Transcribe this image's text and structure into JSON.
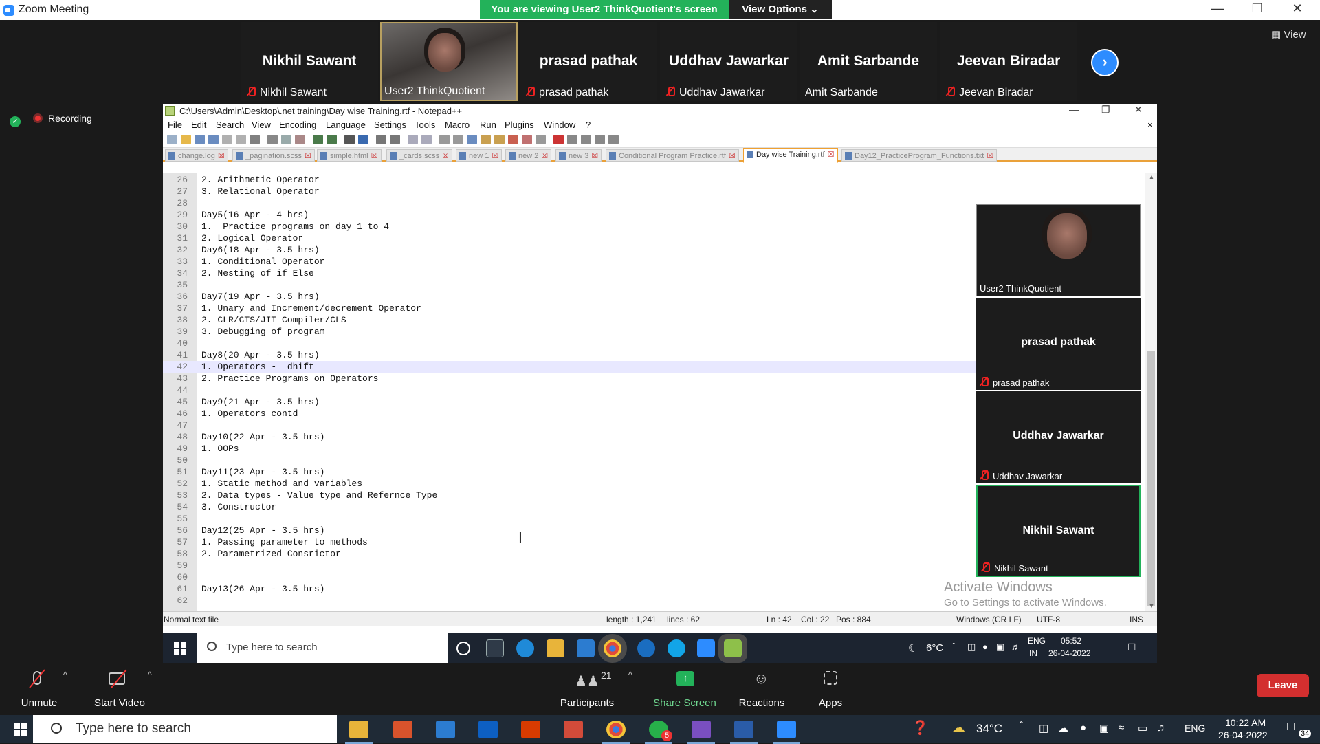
{
  "zoom": {
    "window_title": "Zoom Meeting",
    "viewing_banner": "You are viewing User2 ThinkQuotient's screen",
    "view_options": "View Options ⌄",
    "view_button": "View",
    "recording": "Recording",
    "gallery": [
      {
        "big": "Nikhil Sawant",
        "small": "Nikhil Sawant",
        "muted": true,
        "video": false
      },
      {
        "big": "",
        "small": "User2 ThinkQuotient",
        "muted": false,
        "video": true
      },
      {
        "big": "prasad pathak",
        "small": "prasad pathak",
        "muted": true,
        "video": false
      },
      {
        "big": "Uddhav Jawarkar",
        "small": "Uddhav Jawarkar",
        "muted": true,
        "video": false
      },
      {
        "big": "Amit Sarbande",
        "small": "Amit Sarbande",
        "muted": false,
        "video": false
      },
      {
        "big": "Jeevan Biradar",
        "small": "Jeevan Biradar",
        "muted": true,
        "video": false
      }
    ],
    "toolbar": {
      "unmute": "Unmute",
      "start_video": "Start Video",
      "participants": "Participants",
      "participants_count": "21",
      "share_screen": "Share Screen",
      "reactions": "Reactions",
      "apps": "Apps",
      "leave": "Leave"
    }
  },
  "npp": {
    "title": "C:\\Users\\Admin\\Desktop\\.net training\\Day wise Training.rtf - Notepad++",
    "menu": [
      "File",
      "Edit",
      "Search",
      "View",
      "Encoding",
      "Language",
      "Settings",
      "Tools",
      "Macro",
      "Run",
      "Plugins",
      "Window",
      "?"
    ],
    "tabs": [
      "change.log",
      "_pagination.scss",
      "simple.html",
      "_cards.scss",
      "new 1",
      "new 2",
      "new 3",
      "Conditional Program Practice.rtf",
      "Day wise Training.rtf",
      "Day12_PracticeProgram_Functions.txt"
    ],
    "active_tab": "Day wise Training.rtf",
    "lines": [
      {
        "n": "26",
        "t": "2. Arithmetic Operator"
      },
      {
        "n": "27",
        "t": "3. Relational Operator"
      },
      {
        "n": "28",
        "t": ""
      },
      {
        "n": "29",
        "t": "Day5(16 Apr - 4 hrs)"
      },
      {
        "n": "30",
        "t": "1.  Practice programs on day 1 to 4"
      },
      {
        "n": "31",
        "t": "2. Logical Operator"
      },
      {
        "n": "32",
        "t": "Day6(18 Apr - 3.5 hrs)"
      },
      {
        "n": "33",
        "t": "1. Conditional Operator"
      },
      {
        "n": "34",
        "t": "2. Nesting of if Else"
      },
      {
        "n": "35",
        "t": ""
      },
      {
        "n": "36",
        "t": "Day7(19 Apr - 3.5 hrs)"
      },
      {
        "n": "37",
        "t": "1. Unary and Increment/decrement Operator"
      },
      {
        "n": "38",
        "t": "2. CLR/CTS/JIT Compiler/CLS"
      },
      {
        "n": "39",
        "t": "3. Debugging of program"
      },
      {
        "n": "40",
        "t": ""
      },
      {
        "n": "41",
        "t": "Day8(20 Apr - 3.5 hrs)"
      },
      {
        "n": "42",
        "t": "1. Operators -  dhift"
      },
      {
        "n": "43",
        "t": "2. Practice Programs on Operators"
      },
      {
        "n": "44",
        "t": ""
      },
      {
        "n": "45",
        "t": "Day9(21 Apr - 3.5 hrs)"
      },
      {
        "n": "46",
        "t": "1. Operators contd"
      },
      {
        "n": "47",
        "t": ""
      },
      {
        "n": "48",
        "t": "Day10(22 Apr - 3.5 hrs)"
      },
      {
        "n": "49",
        "t": "1. OOPs"
      },
      {
        "n": "50",
        "t": ""
      },
      {
        "n": "51",
        "t": "Day11(23 Apr - 3.5 hrs)"
      },
      {
        "n": "52",
        "t": "1. Static method and variables"
      },
      {
        "n": "53",
        "t": "2. Data types - Value type and Refernce Type"
      },
      {
        "n": "54",
        "t": "3. Constructor"
      },
      {
        "n": "55",
        "t": ""
      },
      {
        "n": "56",
        "t": "Day12(25 Apr - 3.5 hrs)"
      },
      {
        "n": "57",
        "t": "1. Passing parameter to methods"
      },
      {
        "n": "58",
        "t": "2. Parametrized Consrictor"
      },
      {
        "n": "59",
        "t": ""
      },
      {
        "n": "60",
        "t": ""
      },
      {
        "n": "61",
        "t": "Day13(26 Apr - 3.5 hrs)"
      },
      {
        "n": "62",
        "t": ""
      }
    ],
    "current_line": "42",
    "status": {
      "type": "Normal text file",
      "length": "length : 1,241",
      "lines": "lines : 62",
      "ln": "Ln : 42",
      "col": "Col : 22",
      "pos": "Pos : 884",
      "eol": "Windows (CR LF)",
      "encoding": "UTF-8",
      "mode": "INS"
    }
  },
  "side_panel": [
    {
      "big": "",
      "small": "User2 ThinkQuotient",
      "muted": false,
      "video": true
    },
    {
      "big": "prasad pathak",
      "small": "prasad pathak",
      "muted": true
    },
    {
      "big": "Uddhav Jawarkar",
      "small": "Uddhav Jawarkar",
      "muted": true
    },
    {
      "big": "Nikhil Sawant",
      "small": "Nikhil Sawant",
      "muted": true
    }
  ],
  "activate_windows": {
    "line1": "Activate Windows",
    "line2": "Go to Settings to activate Windows."
  },
  "remote_taskbar": {
    "search_placeholder": "Type here to search",
    "temp": "6°C",
    "lang1": "ENG",
    "lang2": "IN",
    "time": "05:52",
    "date": "26-04-2022"
  },
  "taskbar": {
    "search_placeholder": "Type here to search",
    "temp": "34°C",
    "lang": "ENG",
    "time": "10:22 AM",
    "date": "26-04-2022",
    "notif_count": "34",
    "whatsapp_badge": "5"
  },
  "colors": {
    "zoom_blue": "#2d8cff",
    "banner_green": "#23b25a",
    "leave_red": "#d32f2f",
    "npp_tab_accent": "#eaa13a"
  }
}
